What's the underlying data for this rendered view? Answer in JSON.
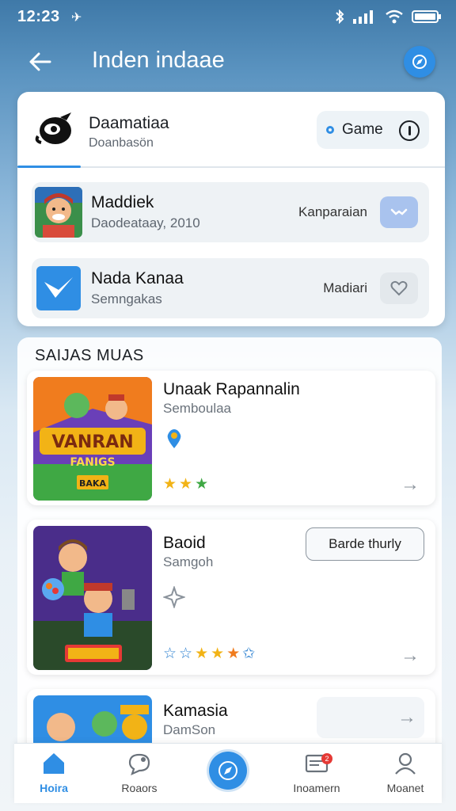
{
  "status_bar": {
    "time": "12:23",
    "location_glyph": "✈"
  },
  "header": {
    "title": "Inden indaae",
    "back_icon": "arrow-left-icon",
    "action_icon": "compass-icon"
  },
  "top_card": {
    "title": "Daamatiaa",
    "subtitle": "Doanbasön",
    "pill_label": "Game",
    "items": [
      {
        "title": "Maddiek",
        "subtitle": "Daodeataay, 2010",
        "action_label": "Kanparaian",
        "btn_color": "#a9c3ee"
      },
      {
        "title": "Nada Kanaa",
        "subtitle": "Semngakas",
        "action_label": "Madiari",
        "btn_color": "#e8edf1"
      }
    ]
  },
  "section": {
    "title": "SAIJAS MUAS",
    "games": [
      {
        "title": "Unaak Rapannalin",
        "subtitle": "Semboulaa",
        "art_text": "VANRAN",
        "art_text2": "FANIGS",
        "art_text3": "BAKA",
        "stars": [
          "#f2b316",
          "#f2b316",
          "#3fa844"
        ]
      },
      {
        "title": "Baoid",
        "subtitle": "Samgoh",
        "button_label": "Barde thurly",
        "stars": [
          "#2a7fd0",
          "#2a7fd0",
          "#f2b316",
          "#f2b316",
          "#f07c1e",
          "#2a7fd0"
        ]
      },
      {
        "title": "Kamasia",
        "subtitle": "DamSon"
      }
    ]
  },
  "bottom_nav": {
    "items": [
      {
        "label": "Hoira",
        "icon": "home-icon"
      },
      {
        "label": "Roaors",
        "icon": "chat-icon"
      },
      {
        "label": "",
        "icon": "compass-icon"
      },
      {
        "label": "Inoamern",
        "icon": "inbox-icon"
      },
      {
        "label": "Moanet",
        "icon": "profile-icon"
      }
    ],
    "badge": "2"
  },
  "colors": {
    "accent": "#2f8ee4",
    "header_bg": "#3f79a8"
  }
}
